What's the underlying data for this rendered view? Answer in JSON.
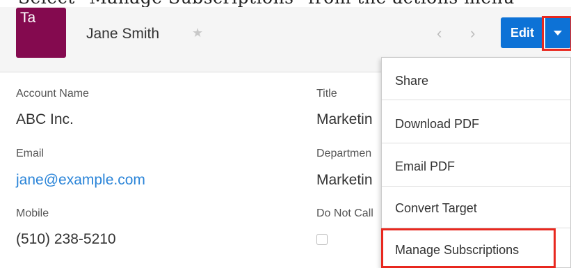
{
  "caption": "Select \"Manage Subscriptions\" from the actions menu",
  "record": {
    "avatar_text": "Ta",
    "avatar_color": "#840a4f",
    "name": "Jane Smith",
    "favorite_icon": "star-icon"
  },
  "header": {
    "prev_icon": "‹",
    "next_icon": "›",
    "edit_label": "Edit",
    "primary_color": "#0d72d6"
  },
  "fields": {
    "account_name": {
      "label": "Account Name",
      "value": "ABC Inc."
    },
    "email": {
      "label": "Email",
      "value": "jane@example.com"
    },
    "mobile": {
      "label": "Mobile",
      "value": "(510) 238-5210"
    },
    "title": {
      "label": "Title",
      "value": "Marketin"
    },
    "department": {
      "label": "Departmen",
      "value": "Marketin"
    },
    "do_not_call": {
      "label": "Do Not Call",
      "checked": false
    }
  },
  "menu": {
    "items": [
      "Share",
      "Download PDF",
      "Email PDF",
      "Convert Target",
      "Manage Subscriptions"
    ]
  },
  "highlight_color": "#e8281f"
}
